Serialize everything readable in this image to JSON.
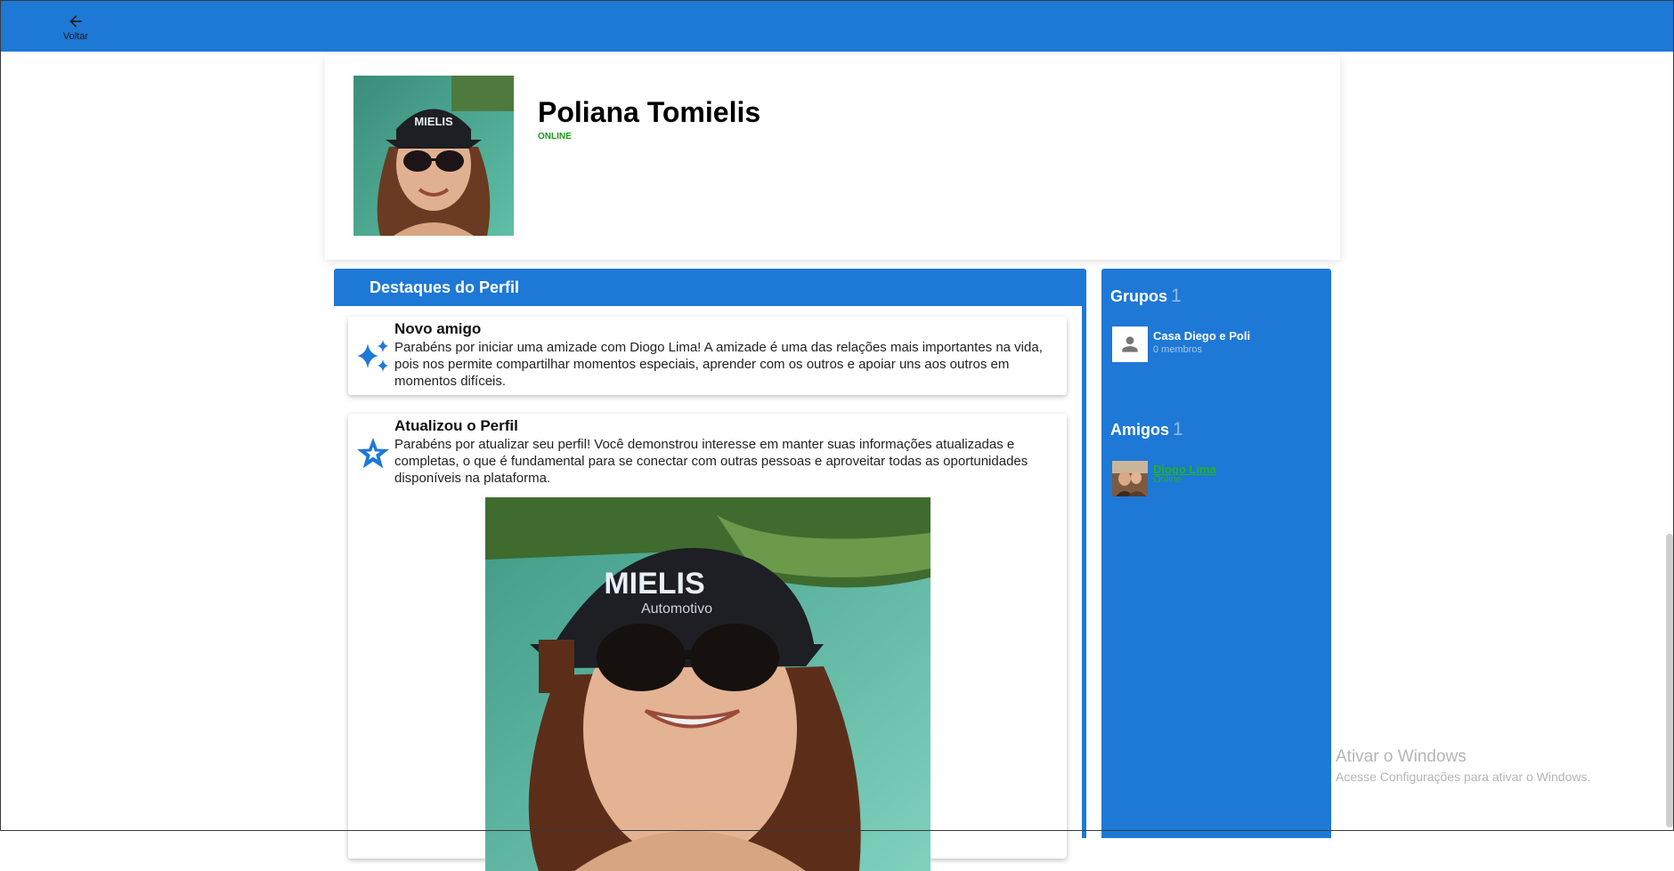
{
  "topbar": {
    "back_label": "Voltar",
    "back_icon": "arrow-left-icon",
    "color": "#1e78d6"
  },
  "profile": {
    "name": "Poliana Tomielis",
    "status": "ONLINE",
    "status_color": "#1a9a1a"
  },
  "highlights": {
    "title": "Destaques do Perfil",
    "items": [
      {
        "icon": "sparkles-icon",
        "title": "Novo amigo",
        "text": "Parabéns por iniciar uma amizade com Diogo Lima! A amizade é uma das relações mais importantes na vida, pois nos permite compartilhar momentos especiais, aprender com os outros e apoiar uns aos outros em momentos difíceis."
      },
      {
        "icon": "star-icon",
        "title": "Atualizou o Perfil",
        "text": "Parabéns por atualizar seu perfil! Você demonstrou interesse em manter suas informações atualizadas e completas, o que é fundamental para se conectar com outras pessoas e aproveitar todas as oportunidades disponíveis na plataforma."
      }
    ]
  },
  "groups": {
    "title": "Grupos",
    "count": "1",
    "items": [
      {
        "name": "Casa Diego e Poli",
        "members": "0 membros"
      }
    ]
  },
  "friends": {
    "title": "Amigos",
    "count": "1",
    "items": [
      {
        "name": "Diogo Lima",
        "status": "Online"
      }
    ]
  },
  "watermark": {
    "line1": "Ativar o Windows",
    "line2": "Acesse Configurações para ativar o Windows."
  }
}
